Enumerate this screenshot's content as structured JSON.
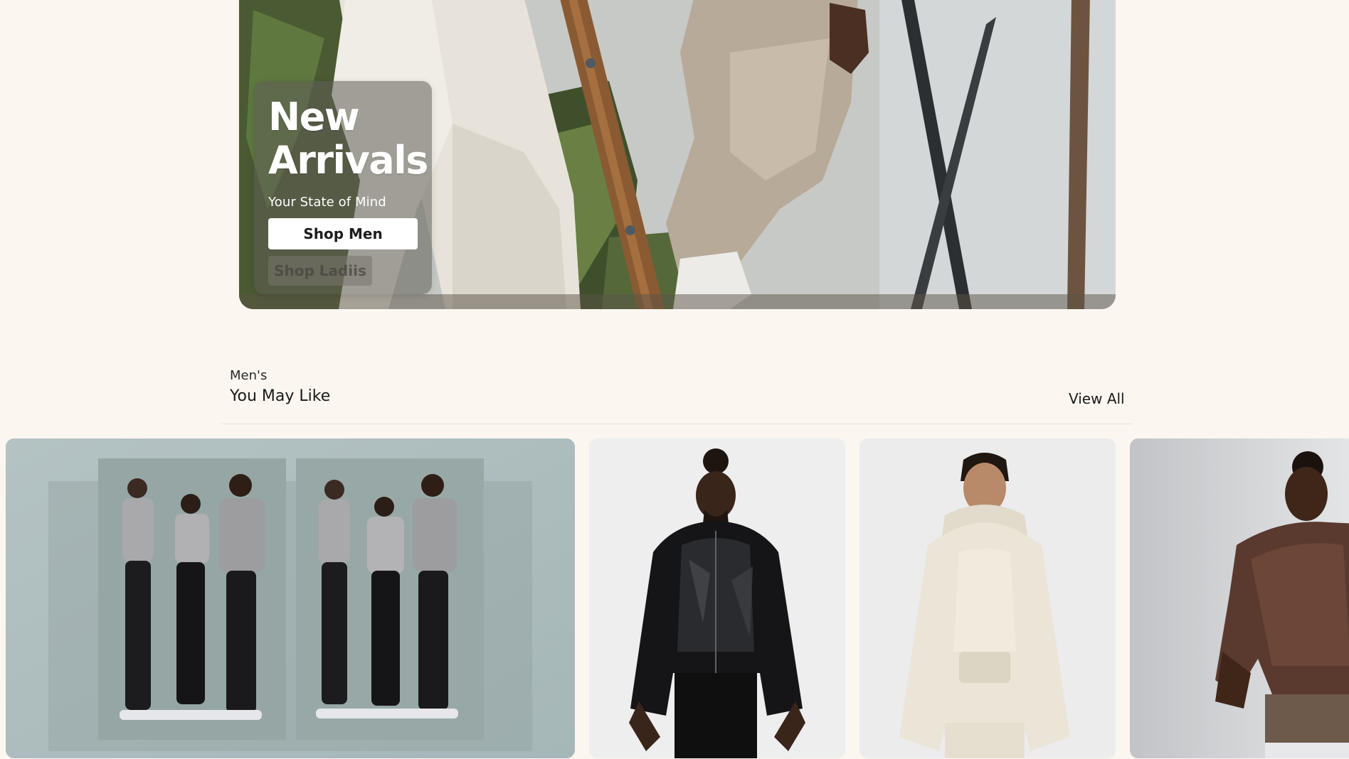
{
  "hero": {
    "title_line1": "New",
    "title_line2": "Arrivals",
    "subtitle": "Your State of Mind",
    "primary_button": "Shop Men",
    "secondary_button": "Shop Ladiis",
    "colors": {
      "card_overlay": "#5f5c54",
      "button_bg": "#ffffff",
      "button_text": "#1d1d1d"
    }
  },
  "section": {
    "eyebrow": "Men's",
    "title": "You May Like",
    "view_all": "View All"
  },
  "products": [
    {
      "name": "feature-lookbook",
      "image": "group-lookbook-photo"
    },
    {
      "name": "black-windbreaker",
      "image": "black-jacket-photo"
    },
    {
      "name": "cream-hoodie",
      "image": "cream-hoodie-photo"
    },
    {
      "name": "brown-crewneck",
      "image": "brown-crewneck-photo"
    }
  ],
  "colors": {
    "page_background": "#fbf6f0",
    "divider": "#e5dfd7",
    "text": "#1a1a1a"
  }
}
